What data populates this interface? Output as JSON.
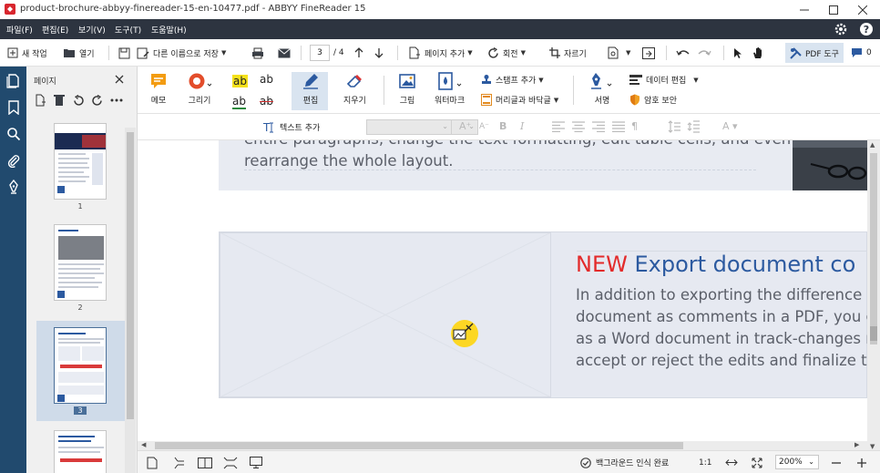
{
  "window": {
    "title": "product-brochure-abbyy-finereader-15-en-10477.pdf - ABBYY FineReader 15"
  },
  "menu": {
    "items": [
      "파일(F)",
      "편집(E)",
      "보기(V)",
      "도구(T)",
      "도움말(H)"
    ]
  },
  "toolbar": {
    "new_task": "새 작업",
    "open": "열기",
    "save_as": "다른 이름으로 저장",
    "page_current": "3",
    "page_total": "/ 4",
    "add_page": "페이지 추가",
    "rotate": "회전",
    "crop": "자르기",
    "pdf_tools": "PDF 도구",
    "comments_count": "0"
  },
  "panel": {
    "title": "페이지",
    "thumbnails": [
      "1",
      "2",
      "3"
    ]
  },
  "ribbon": {
    "note": "메모",
    "draw": "그리기",
    "edit": "편집",
    "erase": "지우기",
    "picture": "그림",
    "watermark": "워터마크",
    "add_stamp": "스탬프 추가",
    "header_footer": "머리글과 바닥글",
    "sign": "서명",
    "data_edit": "데이터 편집",
    "password": "암호 보안",
    "text_ab1": "ab",
    "text_ab2": "ab",
    "text_ab3": "ab",
    "text_ab4": "ab"
  },
  "formatbar": {
    "add_text": "텍스트 추가"
  },
  "document": {
    "line_top1": "entire paragraphs, change the text formatting, edit table cells, and even",
    "line_top2": "rearrange the whole layout.",
    "heading_new": "NEW",
    "heading_rest": " Export document co",
    "para": [
      "In addition to exporting the difference",
      "document as comments in a PDF, you c",
      "as a Word document in track-changes r",
      "accept or reject the edits and finalize the"
    ]
  },
  "status": {
    "background_ocr": "백그라운드 인식 완료",
    "ratio": "1:1",
    "zoom": "200%"
  },
  "colors": {
    "menubar": "#2d3440",
    "rail": "#214a6e",
    "accent": "#2c5aa0",
    "new_red": "#e32b2b"
  }
}
